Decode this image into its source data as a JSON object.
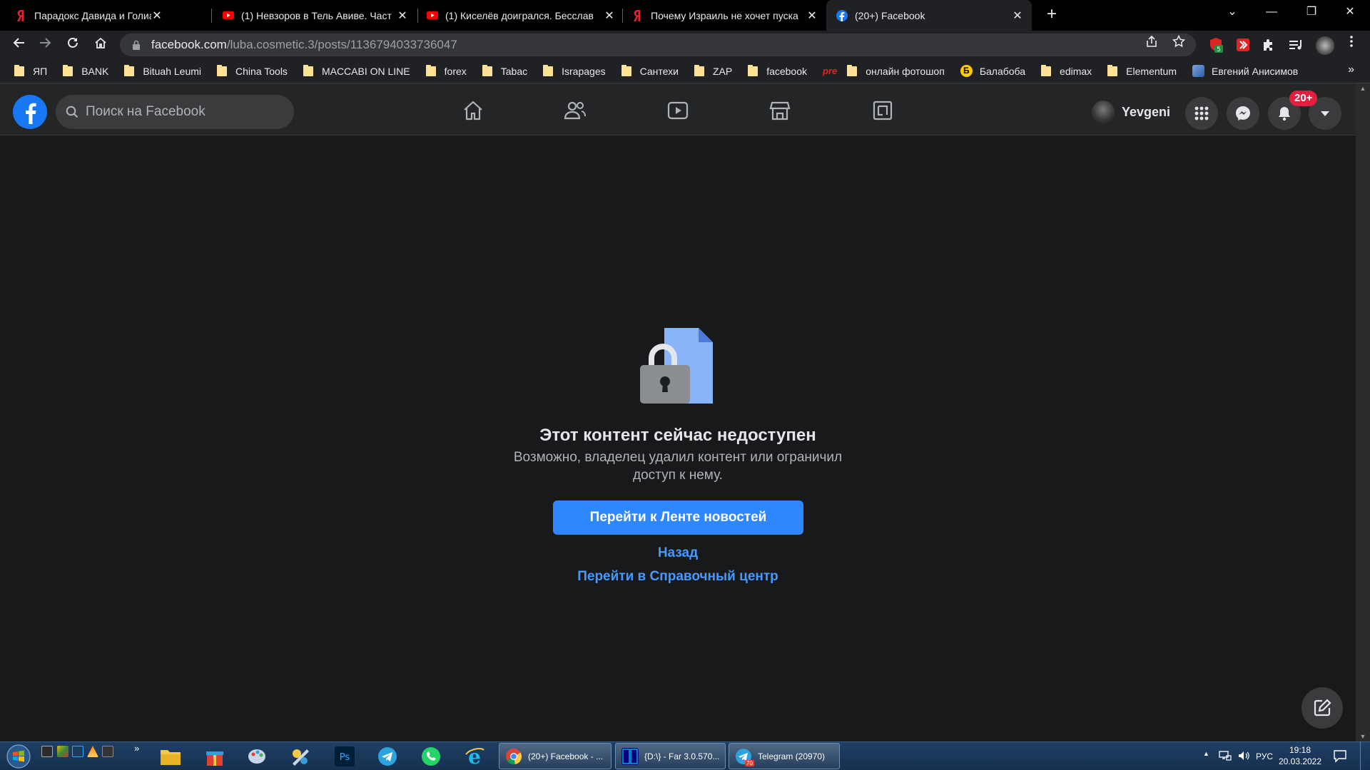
{
  "browser": {
    "tabs": [
      {
        "title": "Парадокс Давида и Голиафа. - Я",
        "icon": "yandex-icon",
        "active": false
      },
      {
        "title": "(1) Невзоров в Тель Авиве. Част",
        "icon": "youtube-icon",
        "active": false
      },
      {
        "title": "(1) Киселёв доигрался. Бесслав",
        "icon": "youtube-icon",
        "active": false
      },
      {
        "title": "Почему Израиль не хочет пуска",
        "icon": "yandex-icon",
        "active": false
      },
      {
        "title": "(20+) Facebook",
        "icon": "facebook-icon",
        "active": true
      }
    ],
    "new_tab": "+",
    "window_controls": {
      "minimize": "—",
      "restore": "❐",
      "close": "✕",
      "tab_search": "⌄"
    },
    "url_host": "facebook.com",
    "url_path": "/luba.cosmetic.3/posts/1136794033736047",
    "extension_badge": "5",
    "bookmarks": [
      {
        "label": "ЯП",
        "icon": "folder"
      },
      {
        "label": "BANK",
        "icon": "folder"
      },
      {
        "label": "Bituah Leumi",
        "icon": "folder"
      },
      {
        "label": "China Tools",
        "icon": "folder"
      },
      {
        "label": "MACCABI ON LINE",
        "icon": "folder"
      },
      {
        "label": "forex",
        "icon": "folder"
      },
      {
        "label": "Tabac",
        "icon": "folder"
      },
      {
        "label": "Israpages",
        "icon": "folder"
      },
      {
        "label": "Сантехи",
        "icon": "folder"
      },
      {
        "label": "ZAP",
        "icon": "folder"
      },
      {
        "label": "facebook",
        "icon": "folder"
      },
      {
        "label": "",
        "icon": "pre-logo",
        "text": "pre"
      },
      {
        "label": "онлайн фотошоп",
        "icon": "folder"
      },
      {
        "label": "Балабоба",
        "icon": "balaboba-icon"
      },
      {
        "label": "edimax",
        "icon": "folder"
      },
      {
        "label": "Elementum",
        "icon": "folder"
      },
      {
        "label": "Евгений Анисимов",
        "icon": "site-icon"
      }
    ],
    "bookmarks_more": "»"
  },
  "facebook": {
    "search_placeholder": "Поиск на Facebook",
    "user_name": "Yevgeni",
    "notifications_badge": "20+",
    "nav_icons": [
      "home-icon",
      "friends-icon",
      "watch-icon",
      "marketplace-icon",
      "gaming-icon"
    ]
  },
  "message": {
    "title": "Этот контент сейчас недоступен",
    "body": "Возможно, владелец удалил контент или ограничил доступ к нему.",
    "primary_button": "Перейти к Ленте новостей",
    "back_link": "Назад",
    "help_link": "Перейти в Справочный центр"
  },
  "taskbar": {
    "buttons": [
      {
        "label": "(20+) Facebook - ...",
        "icon": "chrome-icon"
      },
      {
        "label": "{D:\\} - Far 3.0.570...",
        "icon": "far-icon"
      },
      {
        "label": "Telegram (20970)",
        "icon": "telegram-icon"
      }
    ],
    "telegram_badge": "70",
    "language": "РУС",
    "time": "19:18",
    "date": "20.03.2022",
    "show_hidden": "▲"
  },
  "colors": {
    "fb_blue": "#1877f2",
    "button_blue": "#2d88ff",
    "link_blue": "#4599ff",
    "notif_red": "#e41e3f",
    "page_bg": "#18191a",
    "header_bg": "#242526"
  }
}
